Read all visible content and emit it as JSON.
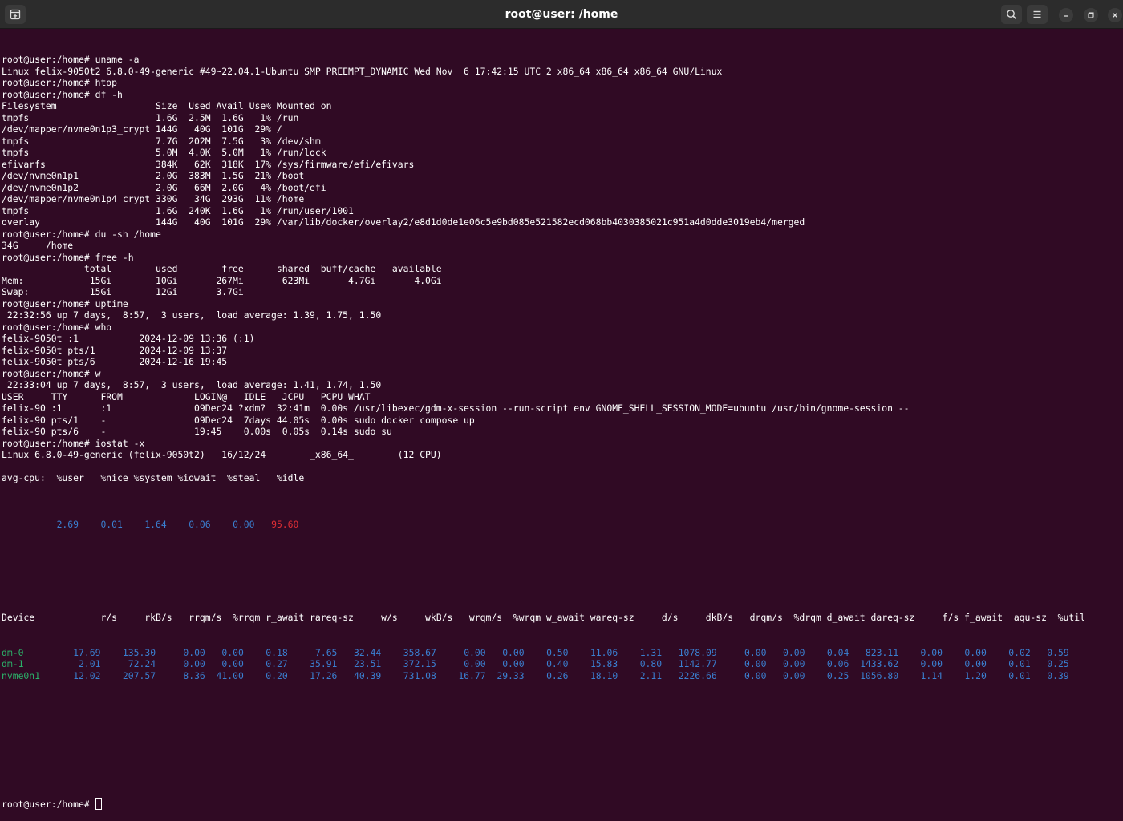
{
  "window": {
    "title": "root@user: /home"
  },
  "terminal": {
    "lines": [
      "root@user:/home# uname -a",
      "Linux felix-9050t2 6.8.0-49-generic #49~22.04.1-Ubuntu SMP PREEMPT_DYNAMIC Wed Nov  6 17:42:15 UTC 2 x86_64 x86_64 x86_64 GNU/Linux",
      "root@user:/home# htop",
      "root@user:/home# df -h",
      "Filesystem                  Size  Used Avail Use% Mounted on",
      "tmpfs                       1.6G  2.5M  1.6G   1% /run",
      "/dev/mapper/nvme0n1p3_crypt 144G   40G  101G  29% /",
      "tmpfs                       7.7G  202M  7.5G   3% /dev/shm",
      "tmpfs                       5.0M  4.0K  5.0M   1% /run/lock",
      "efivarfs                    384K   62K  318K  17% /sys/firmware/efi/efivars",
      "/dev/nvme0n1p1              2.0G  383M  1.5G  21% /boot",
      "/dev/nvme0n1p2              2.0G   66M  2.0G   4% /boot/efi",
      "/dev/mapper/nvme0n1p4_crypt 330G   34G  293G  11% /home",
      "tmpfs                       1.6G  240K  1.6G   1% /run/user/1001",
      "overlay                     144G   40G  101G  29% /var/lib/docker/overlay2/e8d1d0de1e06c5e9bd085e521582ecd068bb4030385021c951a4d0dde3019eb4/merged",
      "root@user:/home# du -sh /home",
      "34G     /home",
      "root@user:/home# free -h",
      "               total        used        free      shared  buff/cache   available",
      "Mem:            15Gi        10Gi       267Mi       623Mi       4.7Gi       4.0Gi",
      "Swap:           15Gi        12Gi       3.7Gi",
      "root@user:/home# uptime",
      " 22:32:56 up 7 days,  8:57,  3 users,  load average: 1.39, 1.75, 1.50",
      "root@user:/home# who",
      "felix-9050t :1           2024-12-09 13:36 (:1)",
      "felix-9050t pts/1        2024-12-09 13:37",
      "felix-9050t pts/6        2024-12-16 19:45",
      "root@user:/home# w",
      " 22:33:04 up 7 days,  8:57,  3 users,  load average: 1.41, 1.74, 1.50",
      "USER     TTY      FROM             LOGIN@   IDLE   JCPU   PCPU WHAT",
      "felix-90 :1       :1               09Dec24 ?xdm?  32:41m  0.00s /usr/libexec/gdm-x-session --run-script env GNOME_SHELL_SESSION_MODE=ubuntu /usr/bin/gnome-session --",
      "felix-90 pts/1    -                09Dec24  7days 44.05s  0.00s sudo docker compose up",
      "felix-90 pts/6    -                19:45    0.00s  0.05s  0.14s sudo su",
      "root@user:/home# iostat -x",
      "Linux 6.8.0-49-generic (felix-9050t2)   16/12/24        _x86_64_        (12 CPU)",
      "",
      "avg-cpu:  %user   %nice %system %iowait  %steal   %idle"
    ],
    "cpu_values": {
      "user": "2.69",
      "nice": "0.01",
      "system": "1.64",
      "iowait": "0.06",
      "steal": "0.00",
      "idle": "95.60"
    },
    "iostat_header": "Device            r/s     rkB/s   rrqm/s  %rrqm r_await rareq-sz     w/s     wkB/s   wrqm/s  %wrqm w_await wareq-sz     d/s     dkB/s   drqm/s  %drqm d_await dareq-sz     f/s f_await  aqu-sz  %util",
    "iostat_rows": [
      {
        "device": "dm-0",
        "values": [
          "17.69",
          "135.30",
          "0.00",
          "0.00",
          "0.18",
          "7.65",
          "32.44",
          "358.67",
          "0.00",
          "0.00",
          "0.50",
          "11.06",
          "1.31",
          "1078.09",
          "0.00",
          "0.00",
          "0.04",
          "823.11",
          "0.00",
          "0.00",
          "0.02",
          "0.59"
        ]
      },
      {
        "device": "dm-1",
        "values": [
          "2.01",
          "72.24",
          "0.00",
          "0.00",
          "0.27",
          "35.91",
          "23.51",
          "372.15",
          "0.00",
          "0.00",
          "0.40",
          "15.83",
          "0.80",
          "1142.77",
          "0.00",
          "0.00",
          "0.06",
          "1433.62",
          "0.00",
          "0.00",
          "0.01",
          "0.25"
        ]
      },
      {
        "device": "nvme0n1",
        "values": [
          "12.02",
          "207.57",
          "8.36",
          "41.00",
          "0.20",
          "17.26",
          "40.39",
          "731.08",
          "16.77",
          "29.33",
          "0.26",
          "18.10",
          "2.11",
          "2226.66",
          "0.00",
          "0.00",
          "0.25",
          "1056.80",
          "1.14",
          "1.20",
          "0.01",
          "0.39"
        ]
      }
    ],
    "prompt": "root@user:/home# "
  },
  "colors": {
    "background": "#300a24",
    "titlebar": "#2c2c2c",
    "value_blue": "#3a7fd0",
    "idle_red": "#e02e35",
    "device_green": "#2bb36a"
  },
  "icons": {
    "new_tab": "new-tab-icon",
    "search": "search-icon",
    "menu": "hamburger-menu-icon",
    "minimize": "minimize-icon",
    "maximize": "maximize-icon",
    "close": "close-icon"
  }
}
